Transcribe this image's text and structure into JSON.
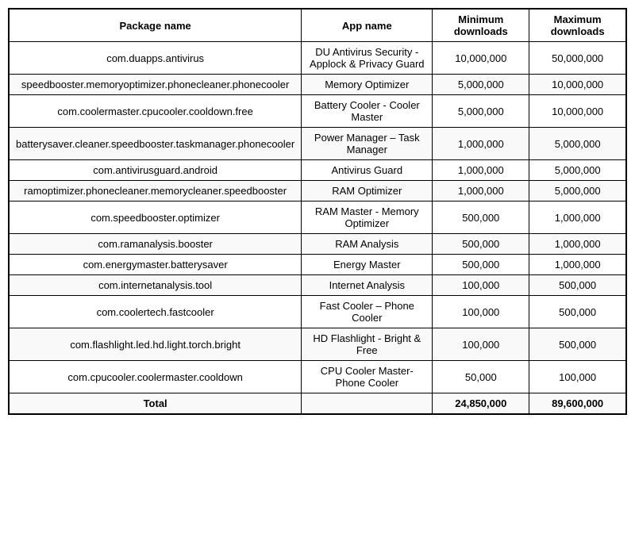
{
  "table": {
    "headers": {
      "package": "Package name",
      "appname": "App name",
      "min_downloads": "Minimum downloads",
      "max_downloads": "Maximum downloads"
    },
    "rows": [
      {
        "package": "com.duapps.antivirus",
        "appname": "DU Antivirus Security - Applock & Privacy Guard",
        "min": "10,000,000",
        "max": "50,000,000"
      },
      {
        "package": "speedbooster.memoryoptimizer.phonecleaner.phonecooler",
        "appname": "Memory Optimizer",
        "min": "5,000,000",
        "max": "10,000,000"
      },
      {
        "package": "com.coolermaster.cpucooler.cooldown.free",
        "appname": "Battery Cooler - Cooler Master",
        "min": "5,000,000",
        "max": "10,000,000"
      },
      {
        "package": "batterysaver.cleaner.speedbooster.taskmanager.phonecooler",
        "appname": "Power Manager – Task Manager",
        "min": "1,000,000",
        "max": "5,000,000"
      },
      {
        "package": "com.antivirusguard.android",
        "appname": "Antivirus Guard",
        "min": "1,000,000",
        "max": "5,000,000"
      },
      {
        "package": "ramoptimizer.phonecleaner.memorycleaner.speedbooster",
        "appname": "RAM Optimizer",
        "min": "1,000,000",
        "max": "5,000,000"
      },
      {
        "package": "com.speedbooster.optimizer",
        "appname": "RAM Master - Memory Optimizer",
        "min": "500,000",
        "max": "1,000,000"
      },
      {
        "package": "com.ramanalysis.booster",
        "appname": "RAM Analysis",
        "min": "500,000",
        "max": "1,000,000"
      },
      {
        "package": "com.energymaster.batterysaver",
        "appname": "Energy Master",
        "min": "500,000",
        "max": "1,000,000"
      },
      {
        "package": "com.internetanalysis.tool",
        "appname": "Internet Analysis",
        "min": "100,000",
        "max": "500,000"
      },
      {
        "package": "com.coolertech.fastcooler",
        "appname": "Fast Cooler – Phone Cooler",
        "min": "100,000",
        "max": "500,000"
      },
      {
        "package": "com.flashlight.led.hd.light.torch.bright",
        "appname": "HD Flashlight - Bright & Free",
        "min": "100,000",
        "max": "500,000"
      },
      {
        "package": "com.cpucooler.coolermaster.cooldown",
        "appname": "CPU Cooler Master- Phone Cooler",
        "min": "50,000",
        "max": "100,000"
      },
      {
        "package": "Total",
        "appname": "",
        "min": "24,850,000",
        "max": "89,600,000",
        "is_total": true
      }
    ]
  }
}
